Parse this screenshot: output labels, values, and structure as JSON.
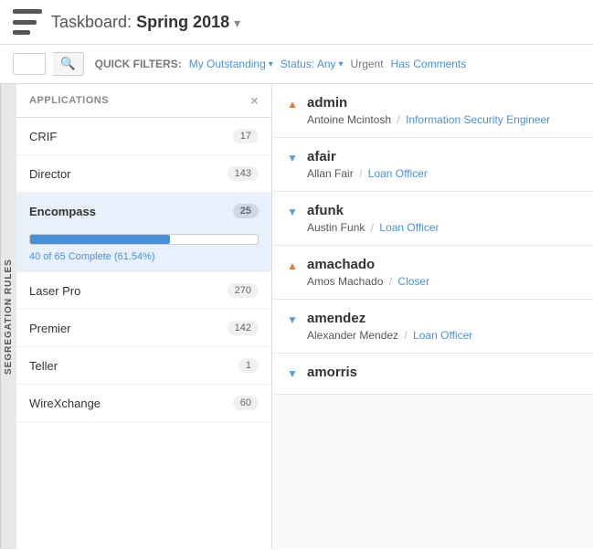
{
  "header": {
    "title_prefix": "Taskboard: ",
    "title_name": "Spring 2018",
    "dropdown_arrow": "▾"
  },
  "toolbar": {
    "quick_filters_label": "QUICK FILTERS:",
    "my_outstanding": "My Outstanding",
    "status_any": "Status: Any",
    "urgent": "Urgent",
    "has_comments": "Has Comments",
    "search_placeholder": ""
  },
  "sidebar_label": "SEGREGATION RULES",
  "apps_panel": {
    "header": "APPLICATIONS",
    "close": "×",
    "items": [
      {
        "name": "CRIF",
        "count": "17",
        "active": false
      },
      {
        "name": "Director",
        "count": "143",
        "active": false
      },
      {
        "name": "Encompass",
        "count": "25",
        "active": true
      },
      {
        "name": "Laser Pro",
        "count": "270",
        "active": false
      },
      {
        "name": "Premier",
        "count": "142",
        "active": false
      },
      {
        "name": "Teller",
        "count": "1",
        "active": false
      },
      {
        "name": "WireXchange",
        "count": "60",
        "active": false
      }
    ],
    "progress": {
      "fill_pct": 61.54,
      "label": "40 of 65 Complete (61.54%)"
    }
  },
  "users": [
    {
      "username": "admin",
      "name": "Antoine Mcintosh",
      "role": "Information Security Engineer",
      "chevron": "up"
    },
    {
      "username": "afair",
      "name": "Allan Fair",
      "role": "Loan Officer",
      "chevron": "down"
    },
    {
      "username": "afunk",
      "name": "Austin Funk",
      "role": "Loan Officer",
      "chevron": "down"
    },
    {
      "username": "amachado",
      "name": "Amos Machado",
      "role": "Closer",
      "chevron": "up"
    },
    {
      "username": "amendez",
      "name": "Alexander Mendez",
      "role": "Loan Officer",
      "chevron": "down"
    },
    {
      "username": "amorris",
      "name": "",
      "role": "",
      "chevron": "down"
    }
  ]
}
